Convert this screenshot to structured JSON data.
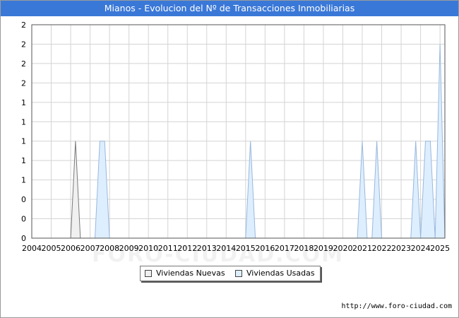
{
  "title": "Mianos - Evolucion del Nº de Transacciones Inmobiliarias",
  "watermark": "FORO-CIUDAD.COM",
  "credit": "http://www.foro-ciudad.com",
  "colors": {
    "title_bg": "#3a78d8",
    "nuevas_fill": "#f0f0f0",
    "nuevas_stroke": "#7a7a7a",
    "usadas_fill": "#ddeeff",
    "usadas_stroke": "#9ab8dd",
    "grid": "#d4d4d4"
  },
  "legend": {
    "position": "bottom-center",
    "items": [
      {
        "label": "Viviendas Nuevas",
        "color": "#f0f0f0"
      },
      {
        "label": "Viviendas Usadas",
        "color": "#ddeeff"
      }
    ]
  },
  "chart_data": {
    "type": "area",
    "title": "Mianos - Evolucion del Nº de Transacciones Inmobiliarias",
    "x_ticks": [
      "2004",
      "2005",
      "2006",
      "2007",
      "2008",
      "2009",
      "2010",
      "2011",
      "2012",
      "2013",
      "2014",
      "2015",
      "2016",
      "2017",
      "2018",
      "2019",
      "2020",
      "2021",
      "2022",
      "2023",
      "2024",
      "2025"
    ],
    "y_tick_labels": [
      "0",
      "0",
      "0",
      "1",
      "1",
      "1",
      "1",
      "1",
      "2",
      "2",
      "2",
      "2"
    ],
    "ylim": [
      0,
      2.2
    ],
    "xlim": [
      2004,
      2025.25
    ],
    "grid": true,
    "series": [
      {
        "name": "Viviendas Nuevas",
        "points": [
          [
            2006.0,
            0
          ],
          [
            2006.25,
            1
          ],
          [
            2006.5,
            0
          ]
        ]
      },
      {
        "name": "Viviendas Usadas",
        "points": [
          [
            2007.25,
            0
          ],
          [
            2007.5,
            1
          ],
          [
            2007.75,
            1
          ],
          [
            2008.0,
            0
          ],
          [
            2015.0,
            0
          ],
          [
            2015.25,
            1
          ],
          [
            2015.5,
            0
          ],
          [
            2020.75,
            0
          ],
          [
            2021.0,
            1
          ],
          [
            2021.25,
            0
          ],
          [
            2021.5,
            0
          ],
          [
            2021.75,
            1
          ],
          [
            2022.0,
            0
          ],
          [
            2023.5,
            0
          ],
          [
            2023.75,
            1
          ],
          [
            2024.0,
            0
          ],
          [
            2024.0,
            0
          ],
          [
            2024.25,
            1
          ],
          [
            2024.5,
            1
          ],
          [
            2024.75,
            0
          ],
          [
            2024.75,
            0
          ],
          [
            2025.0,
            2
          ],
          [
            2025.25,
            0
          ]
        ]
      }
    ]
  }
}
